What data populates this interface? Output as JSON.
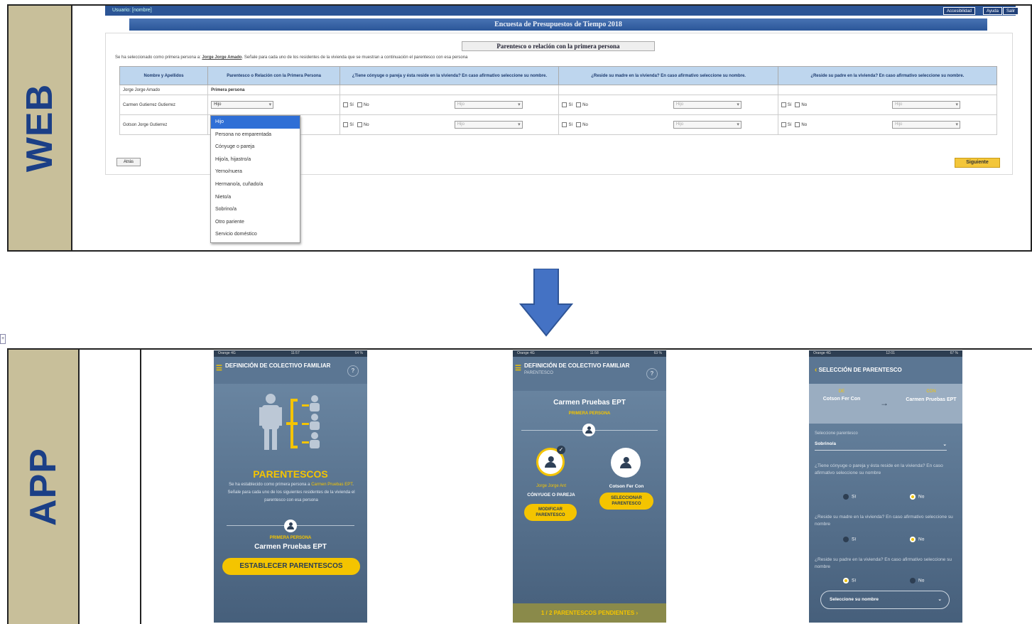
{
  "web": {
    "side_label": "WEB",
    "topbar": {
      "user": "Usuario: [nombre]",
      "buttons": [
        "Accesibilidad",
        "Ayuda",
        "Salir"
      ]
    },
    "survey_title": "Encuesta de Presupuestos de Tiempo 2018",
    "panel_title": "Parentesco o relación con la primera persona",
    "intro_text": "Se ha seleccionado como primera persona a:",
    "intro_name": "Jorge Jorge Amado",
    "intro_text2": ". Señale para cada uno de los residentes de la vivienda que se muestran a continuación el parentesco con esa persona",
    "columns": [
      "Nombre y Apellidos",
      "Parentesco o Relación con la Primera Persona",
      "¿Tiene cónyuge o pareja y ésta reside en la vivienda? En caso afirmativo seleccione su nombre.",
      "¿Reside su madre en la vivienda? En caso afirmativo seleccione su nombre.",
      "¿Reside su padre en la vivienda? En caso afirmativo seleccione su nombre."
    ],
    "rows": [
      {
        "name": "Jorge Jorge Amado",
        "relation": "Primera persona"
      },
      {
        "name": "Carmen Gutierrez Gutierrez",
        "relation": "Hijo"
      },
      {
        "name": "Gotson Jorge Gutierrez",
        "relation": ""
      }
    ],
    "yes": "Sí",
    "no": "No",
    "select_placeholder": "Hijo",
    "dropdown_options": [
      "Hijo",
      "Persona no emparentada",
      "Cónyuge o pareja",
      "Hijo/a, hijastro/a",
      "Yerno/nuera",
      "Hermano/a, cuñado/a",
      "Nieto/a",
      "Sobrino/a",
      "Otro pariente",
      "Servicio doméstico"
    ],
    "btn_back": "Atrás",
    "btn_next": "Siguiente"
  },
  "app": {
    "side_label": "APP",
    "phone1": {
      "status_left": "Orange 4G",
      "status_time": "11:57",
      "status_right": "64 %",
      "header": "DEFINICIÓN DE COLECTIVO FAMILIAR",
      "help": "?",
      "title": "PARENTESCOS",
      "text1": "Se ha establecido como primera persona a",
      "text_name": "Carmen Pruebas EPT",
      "text2": ". Señale para cada uno de los siguientes residentes de la vivienda el parentesco con esa persona",
      "first_label": "PRIMERA PERSONA",
      "first_name": "Carmen Pruebas EPT",
      "button": "ESTABLECER PARENTESCOS"
    },
    "phone2": {
      "status_left": "Orange 4G",
      "status_time": "11:58",
      "status_right": "63 %",
      "header": "DEFINICIÓN DE COLECTIVO FAMILIAR",
      "subheader": "PARENTESCO",
      "help": "?",
      "main_name": "Carmen Pruebas EPT",
      "main_role": "PRIMERA PERSONA",
      "p1_name": "Jorge Jorge Ant",
      "p1_rel": "CÓNYUGE O PAREJA",
      "p1_btn": "MODIFICAR PARENTESCO",
      "p2_name": "Cotson Fer Con",
      "p2_btn": "SELECCIONAR PARENTESCO",
      "footer": "1 / 2 PARENTESCOS PENDIENTES"
    },
    "phone3": {
      "status_left": "Orange 4G",
      "status_time": "12:01",
      "status_right": "67 %",
      "header": "SELECCIÓN DE PARENTESCO",
      "from_label": "DE",
      "from_name": "Cotson Fer Con",
      "to_label": "CON",
      "to_name": "Carmen Pruebas EPT",
      "select_label": "Seleccione parentesco",
      "select_value": "Sobrino/a",
      "q1": "¿Tiene cónyuge o pareja y ésta reside en la vivienda? En caso afirmativo seleccione su nombre",
      "q2": "¿Reside su madre en la vivienda? En caso afirmativo seleccione su nombre",
      "q3": "¿Reside su padre en la vivienda? En caso afirmativo seleccione su nombre",
      "yes": "Sí",
      "no": "No",
      "name_select": "Seleccione su nombre"
    }
  },
  "colors": {
    "accent": "#f4c400",
    "blue": "#2c5596",
    "sidebar": "#c8bf9a",
    "arrow": "#4472c4"
  }
}
